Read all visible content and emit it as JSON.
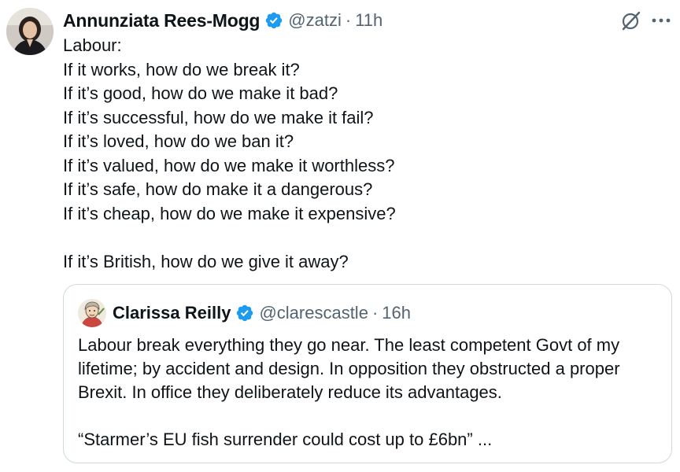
{
  "tweet": {
    "author_name": "Annunziata Rees-Mogg",
    "handle": "@zatzi",
    "separator": "·",
    "time": "11h",
    "avatar_icon": "profile-photo",
    "verified_icon": "verified-badge-icon",
    "lines": [
      "Labour:",
      "If it works, how do we break it?",
      "If it’s good, how do we make it bad?",
      "If it’s successful, how do we make it fail?",
      "If it’s loved, how do we ban it?",
      "If it’s valued, how do we make it worthless?",
      "If it’s safe, how do make it a dangerous?",
      "If it’s cheap, how do we make it expensive?",
      "",
      "If it’s British, how do we give it away?"
    ]
  },
  "header_actions": {
    "grok_icon": "grok-icon",
    "more_icon": "more-options-icon"
  },
  "quote": {
    "author_name": "Clarissa Reilly",
    "handle": "@clarescastle",
    "separator": "·",
    "time": "16h",
    "avatar_icon": "profile-avatar",
    "lines": [
      "Labour break everything they go near. The least competent Govt of my",
      "lifetime; by accident and design. In opposition they obstructed a proper",
      "Brexit. In office they deliberately reduce its advantages.",
      "",
      "“Starmer’s EU fish surrender could cost up to £6bn” ..."
    ]
  },
  "colors": {
    "text_primary": "#0f1419",
    "text_secondary": "#536471",
    "verified_blue": "#1d9bf0",
    "border": "#cfd9de"
  }
}
